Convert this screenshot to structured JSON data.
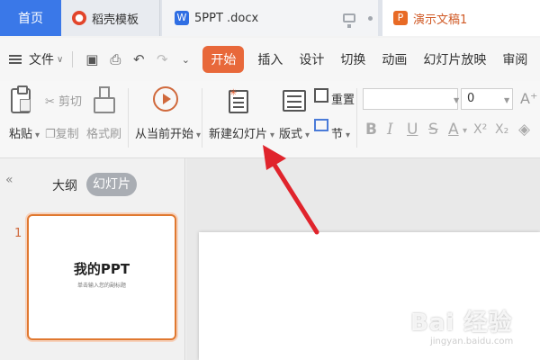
{
  "tabs": {
    "home": "首页",
    "daoke": "稻壳模板",
    "doc": "5PPT .docx",
    "ppt": "演示文稿1",
    "doc_icon_letter": "W",
    "ppt_icon_letter": "P"
  },
  "menu": {
    "file": "文件",
    "tabs": [
      "开始",
      "插入",
      "设计",
      "切换",
      "动画",
      "幻灯片放映",
      "审阅"
    ],
    "active_tab": "开始"
  },
  "ribbon": {
    "paste": "粘贴",
    "cut": "剪切",
    "copy": "复制",
    "format_painter": "格式刷",
    "from_current": "从当前开始",
    "new_slide": "新建幻灯片",
    "layout": "版式",
    "reset": "重置",
    "section": "节",
    "font_size": "0",
    "bold": "B",
    "italic": "I",
    "underline": "U",
    "strike": "S",
    "font_color": "A",
    "superscript": "X²",
    "subscript": "X₂",
    "grow_font": "A⁺"
  },
  "panel": {
    "outline": "大纲",
    "slides": "幻灯片",
    "slide_number": "1",
    "thumb_title": "我的PPT",
    "thumb_subtitle": "单击输入您的副标题"
  },
  "watermark": {
    "main": "Bai 经验",
    "sub": "jingyan.baidu.com"
  },
  "colors": {
    "accent": "#e8683a",
    "home_tab": "#3a78e8",
    "arrow": "#e0242c"
  }
}
